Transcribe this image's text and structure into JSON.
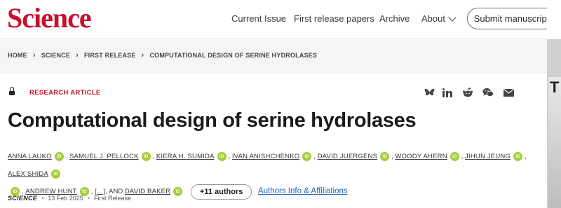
{
  "header": {
    "logo": "Science",
    "nav": {
      "current_issue": "Current Issue",
      "first_release": "First release papers",
      "archive": "Archive",
      "about": "About"
    },
    "submit_label": "Submit manuscript"
  },
  "breadcrumb": [
    "HOME",
    "SCIENCE",
    "FIRST RELEASE",
    "COMPUTATIONAL DESIGN OF SERINE HYDROLASES"
  ],
  "article": {
    "type": "RESEARCH ARTICLE",
    "title": "Computational design of serine hydrolases",
    "authors": [
      "ANNA LAUKO",
      "SAMUEL J. PELLOCK",
      "KIERA H. SUMIDA",
      "IVAN ANISHCHENKO",
      "DAVID JUERGENS",
      "WOODY AHERN",
      "JIHUN JEUNG",
      "ALEX SHIDA",
      "ANDREW HUNT",
      "DAVID BAKER"
    ],
    "ellipsis": "[…]",
    "and_label": "AND",
    "more_authors": "+11 authors",
    "affiliations_link": "Authors Info & Affiliations",
    "journal": "SCIENCE",
    "date": "13 Feb 2025",
    "status": "First Release"
  },
  "share_icons": [
    "bluesky-icon",
    "linkedin-icon",
    "reddit-icon",
    "wechat-icon",
    "email-icon"
  ],
  "colors": {
    "brand": "#c8102e",
    "orcid": "#a6ce39",
    "link": "#1f62b8"
  }
}
